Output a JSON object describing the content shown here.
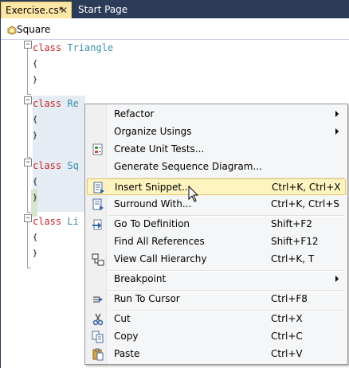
{
  "tabs": [
    {
      "label": "Exercise.cs*",
      "close": "✕"
    },
    {
      "label": "Start Page"
    }
  ],
  "navbar": {
    "label": "Square",
    "icon": "class-icon"
  },
  "code": {
    "kw": "class",
    "types": [
      "Triangle",
      "Re",
      "Sq",
      "Li"
    ],
    "open_brace": "{",
    "close_brace": "}",
    "fold": "−"
  },
  "menu": {
    "items": [
      {
        "label": "Refactor",
        "submenu": true
      },
      {
        "label": "Organize Usings",
        "submenu": true
      },
      {
        "label": "Create Unit Tests...",
        "icon": "unit-test-icon"
      },
      {
        "label": "Generate Sequence Diagram..."
      },
      {
        "label": "Insert Snippet...",
        "shortcut": "Ctrl+K, Ctrl+X",
        "icon": "snippet-icon",
        "highlighted": true
      },
      {
        "label": "Surround With...",
        "shortcut": "Ctrl+K, Ctrl+S",
        "icon": "surround-icon"
      },
      {
        "label": "Go To Definition",
        "shortcut": "Shift+F2",
        "icon": "go-to-definition-icon"
      },
      {
        "label": "Find All References",
        "shortcut": "Shift+F12"
      },
      {
        "label": "View Call Hierarchy",
        "shortcut": "Ctrl+K, T",
        "icon": "call-hierarchy-icon"
      },
      {
        "label": "Breakpoint",
        "submenu": true
      },
      {
        "label": "Run To Cursor",
        "shortcut": "Ctrl+F8",
        "icon": "run-to-cursor-icon"
      },
      {
        "label": "Cut",
        "shortcut": "Ctrl+X",
        "icon": "scissors-icon"
      },
      {
        "label": "Copy",
        "shortcut": "Ctrl+C",
        "icon": "copy-icon"
      },
      {
        "label": "Paste",
        "shortcut": "Ctrl+V",
        "icon": "paste-icon"
      }
    ]
  },
  "colors": {
    "tab_active": "#fde7a6",
    "keyword": "#c62626",
    "type": "#3a8ea8",
    "menu_hover": "#fdf4bf"
  }
}
